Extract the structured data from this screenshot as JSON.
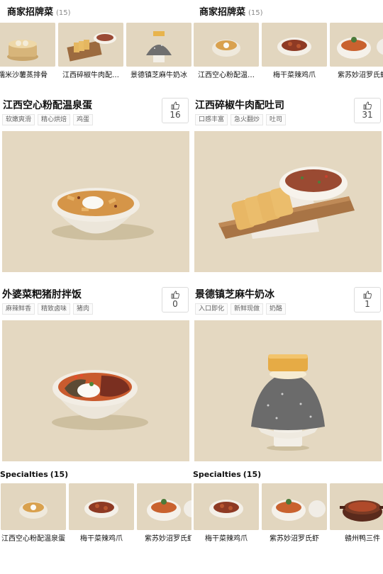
{
  "top_strip": {
    "left": {
      "title": "商家招牌菜",
      "count": "(15)",
      "items": [
        {
          "label": "糯米沙薯蒸排骨",
          "icon": "bamboo-steamer"
        },
        {
          "label": "江西碎椒牛肉配…",
          "icon": "toast-and-bowl"
        },
        {
          "label": "景德镇芝麻牛奶冰",
          "icon": "sesame-ice"
        }
      ]
    },
    "right": {
      "title": "商家招牌菜",
      "count": "(15)",
      "items": [
        {
          "label": "江西空心粉配温…",
          "icon": "pasta-bowl"
        },
        {
          "label": "梅干菜辣鸡爪",
          "icon": "chicken-bowl"
        },
        {
          "label": "紫苏妙沼罗氏虾",
          "icon": "shrimp-bowl"
        }
      ]
    }
  },
  "dishes": [
    {
      "title": "江西空心粉配温泉蛋",
      "tags": [
        "软嫩爽滑",
        "精心烘焙",
        "鸡蛋"
      ],
      "likes": "16",
      "icon": "pasta-egg-bowl"
    },
    {
      "title": "江西碎椒牛肉配吐司",
      "tags": [
        "口感丰富",
        "急火翻炒",
        "吐司"
      ],
      "likes": "31",
      "icon": "toast-beef-board"
    },
    {
      "title": "外婆菜粑猪肘拌饭",
      "tags": [
        "麻辣鲜香",
        "精致卤味",
        "猪肉"
      ],
      "likes": "0",
      "icon": "pork-rice-bowl"
    },
    {
      "title": "景德镇芝麻牛奶冰",
      "tags": [
        "入口即化",
        "新鲜现做",
        "奶酪"
      ],
      "likes": "1",
      "icon": "sesame-milk-ice"
    }
  ],
  "bottom_strip": {
    "left": {
      "title": "Specialties",
      "count": "(15)",
      "items": [
        {
          "label": "江西空心粉配温泉蛋",
          "icon": "pasta-bowl"
        },
        {
          "label": "梅干菜辣鸡爪",
          "icon": "chicken-bowl"
        },
        {
          "label": "紫苏妙沼罗氏虾",
          "icon": "shrimp-bowl"
        }
      ]
    },
    "right": {
      "title": "Specialties",
      "count": "(15)",
      "items": [
        {
          "label": "梅干菜辣鸡爪",
          "icon": "chicken-bowl"
        },
        {
          "label": "紫苏妙沼罗氏虾",
          "icon": "shrimp-bowl"
        },
        {
          "label": "赣州鸭三件",
          "icon": "duck-pot"
        }
      ]
    }
  },
  "colors": {
    "photo_bg": "#e4d8c1",
    "thumb_bg": "#e2d6bf",
    "text": "#111111",
    "muted": "#8a8a8a"
  }
}
